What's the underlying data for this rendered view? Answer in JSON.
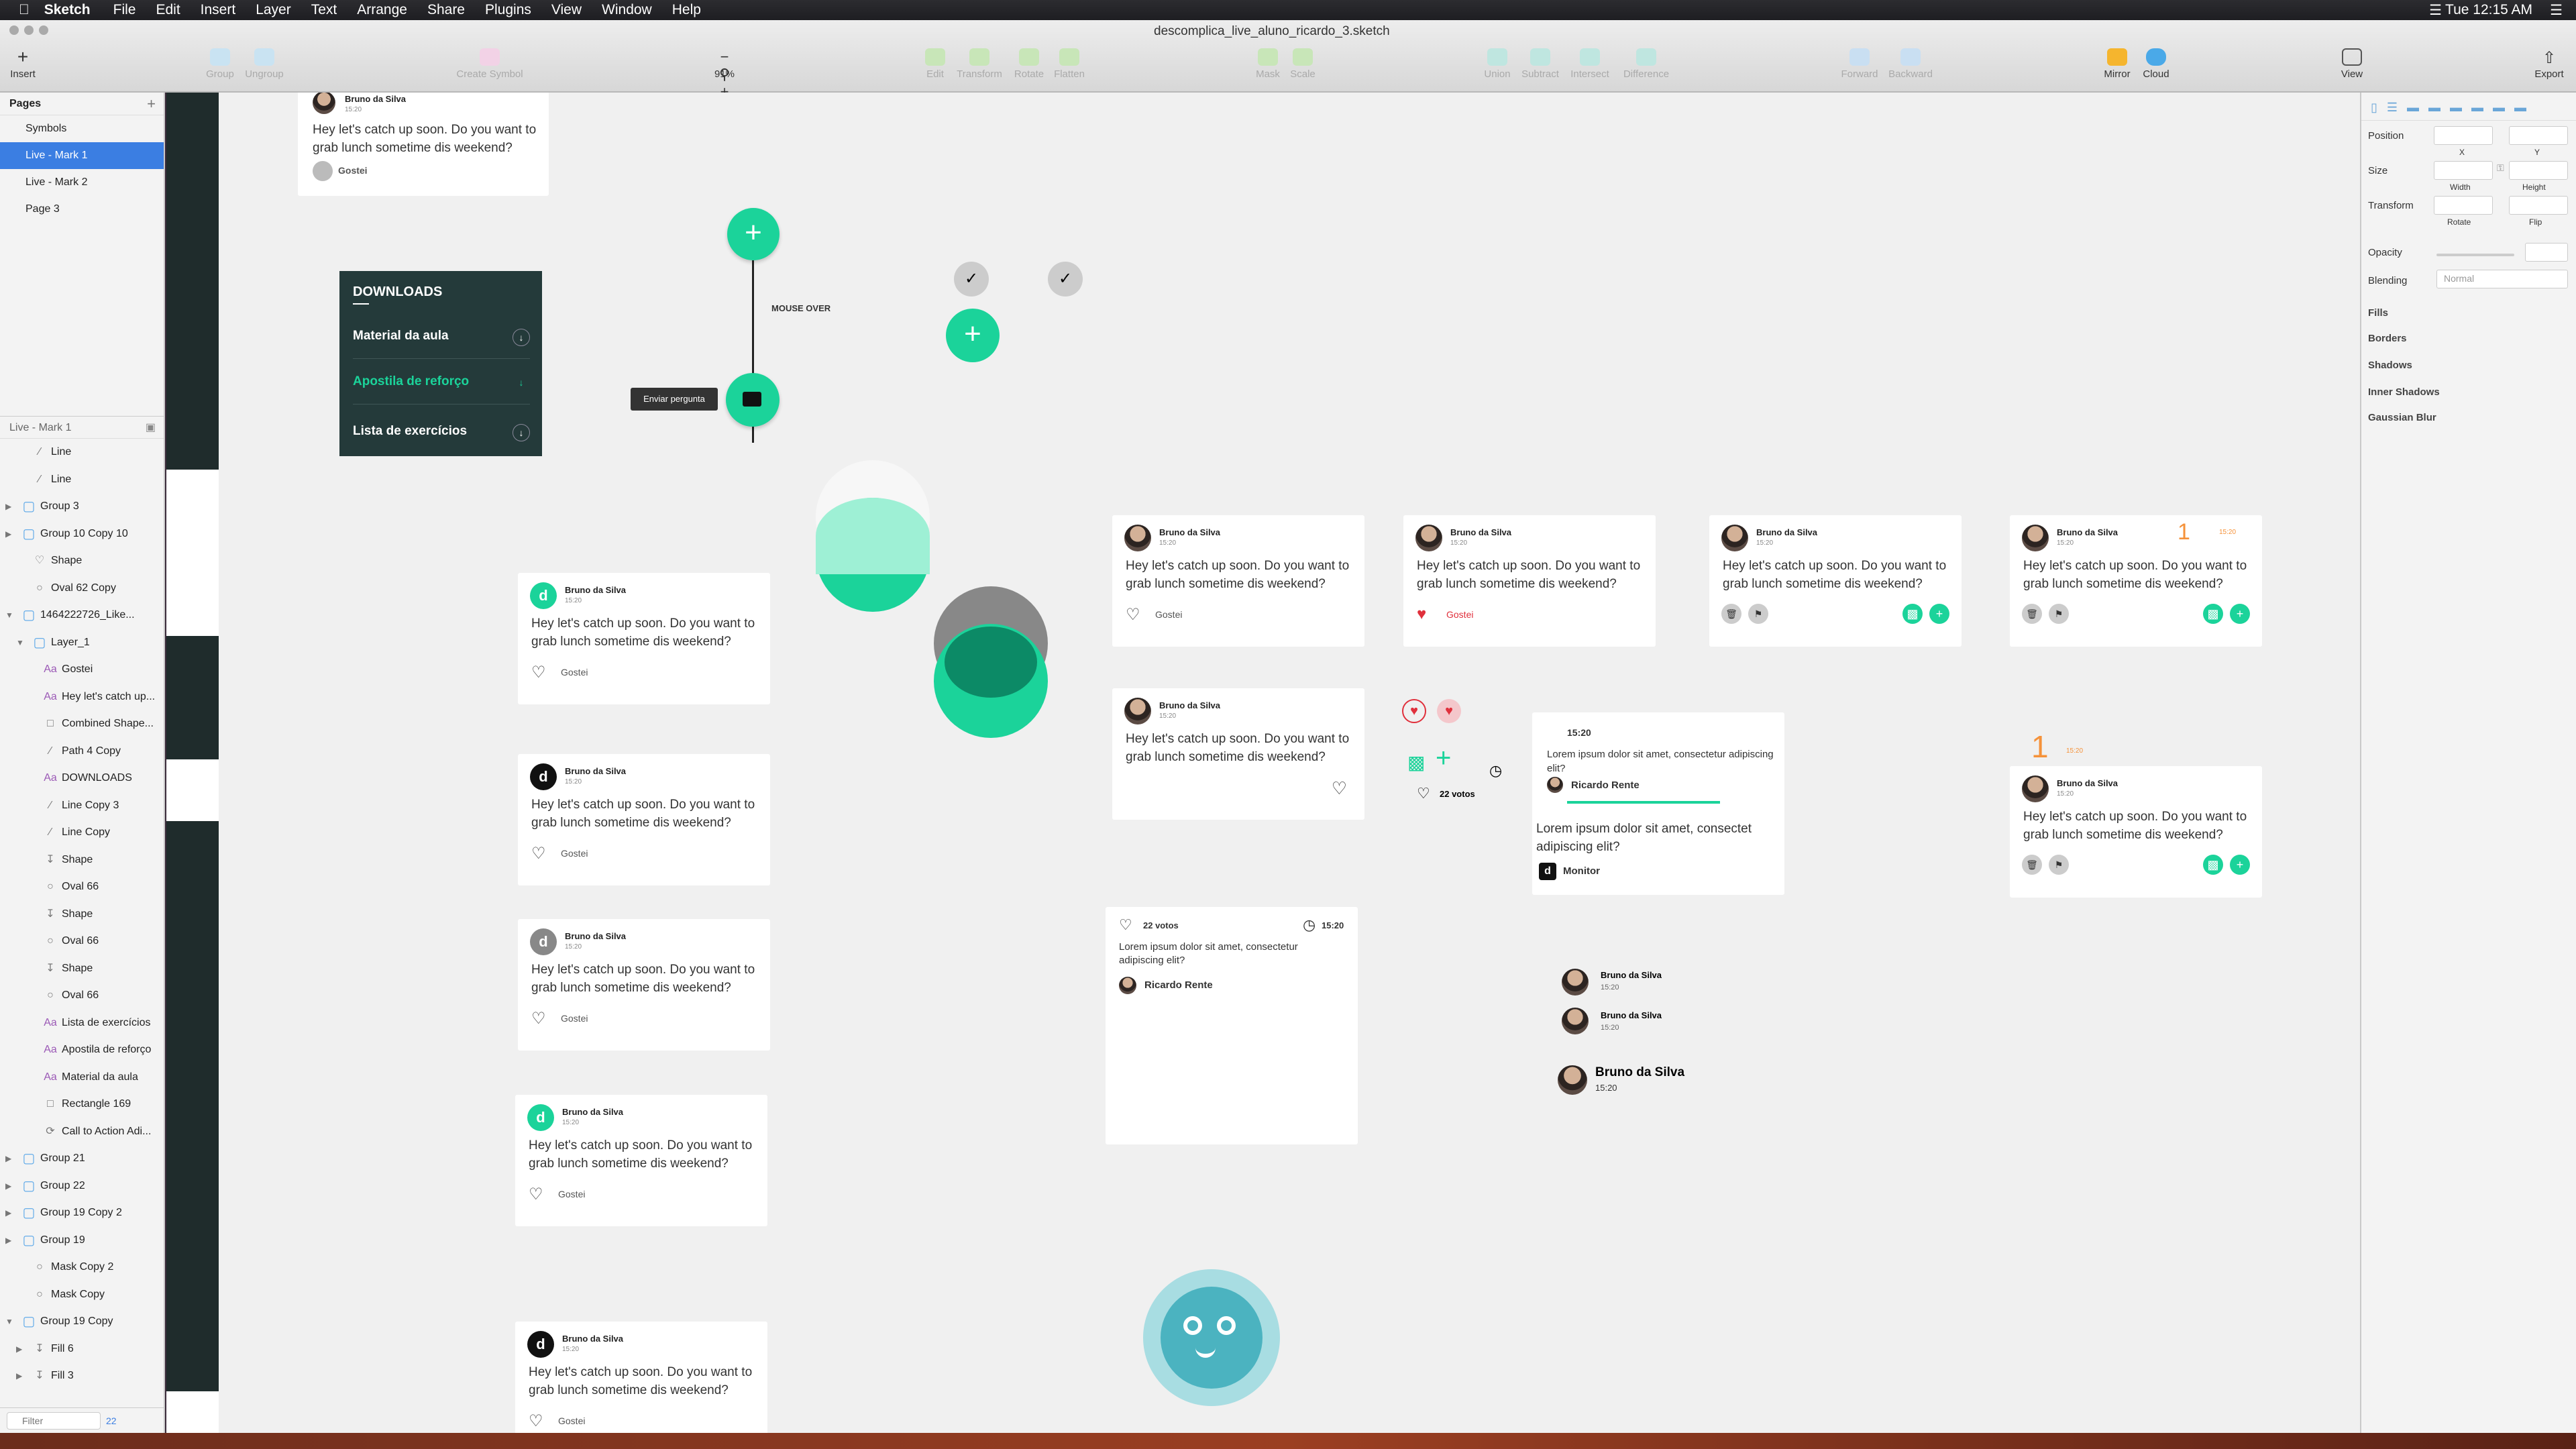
{
  "menubar": {
    "app": "Sketch",
    "items": [
      "File",
      "Edit",
      "Insert",
      "Layer",
      "Text",
      "Arrange",
      "Share",
      "Plugins",
      "View",
      "Window",
      "Help"
    ],
    "clock": "Tue 12:15 AM"
  },
  "toolbar": {
    "doc_title": "descomplica_live_aluno_ricardo_3.sketch",
    "zoom": "91%",
    "insert": "Insert",
    "group": "Group",
    "ungroup": "Ungroup",
    "create_symbol": "Create Symbol",
    "edit": "Edit",
    "transform": "Transform",
    "rotate": "Rotate",
    "flatten": "Flatten",
    "mask": "Mask",
    "scale": "Scale",
    "union": "Union",
    "subtract": "Subtract",
    "intersect": "Intersect",
    "difference": "Difference",
    "forward": "Forward",
    "backward": "Backward",
    "mirror": "Mirror",
    "cloud": "Cloud",
    "view": "View",
    "export": "Export"
  },
  "pages": {
    "header": "Pages",
    "items": [
      "Symbols",
      "Live - Mark 1",
      "Live - Mark 2",
      "Page 3"
    ]
  },
  "layers": {
    "header": "Live - Mark 1",
    "filter_placeholder": "Filter",
    "count": "22",
    "items": [
      "Line",
      "Line",
      "Group 3",
      "Group 10 Copy 10",
      "Shape",
      "Oval 62 Copy",
      "1464222726_Like...",
      "Layer_1",
      "Gostei",
      "Hey let's catch up...",
      "Combined Shape...",
      "Path 4 Copy",
      "DOWNLOADS",
      "Line Copy 3",
      "Line Copy",
      "Shape",
      "Oval 66",
      "Shape",
      "Oval 66",
      "Shape",
      "Oval 66",
      "Lista de exercícios",
      "Apostila de reforço",
      "Material da aula",
      "Rectangle 169",
      "Call to Action Adi...",
      "Group 21",
      "Group 22",
      "Group 19 Copy 2",
      "Group 19",
      "Mask Copy 2",
      "Mask Copy",
      "Group 19 Copy",
      "Fill 6",
      "Fill 3"
    ]
  },
  "inspector": {
    "position": "Position",
    "x": "X",
    "y": "Y",
    "size": "Size",
    "width": "Width",
    "height": "Height",
    "transform": "Transform",
    "rotate": "Rotate",
    "flip": "Flip",
    "opacity": "Opacity",
    "blending": "Blending",
    "blending_value": "Normal",
    "fills": "Fills",
    "borders": "Borders",
    "shadows": "Shadows",
    "inner_shadows": "Inner Shadows",
    "gaussian_blur": "Gaussian Blur"
  },
  "canvas": {
    "user": "Bruno da Silva",
    "time": "15:20",
    "message": "Hey let's catch up soon. Do you want to grab lunch sometime dis weekend?",
    "like": "Gostei",
    "downloads": {
      "title": "DOWNLOADS",
      "items": [
        "Material da aula",
        "Apostila de reforço",
        "Lista de exercícios"
      ]
    },
    "mouse_over": "MOUSE OVER",
    "tooltip": "Enviar pergunta",
    "lorem": "Lorem ipsum dolor sit amet, consectetur adipiscing elit?",
    "lorem2": "Lorem ipsum dolor sit amet, consectet adipiscing elit?",
    "ricardo": "Ricardo Rente",
    "monitor": "Monitor",
    "votes": "22 votos",
    "badge": "1",
    "accent": "#1bd39a",
    "dark_panel": "#1f3a3a"
  }
}
